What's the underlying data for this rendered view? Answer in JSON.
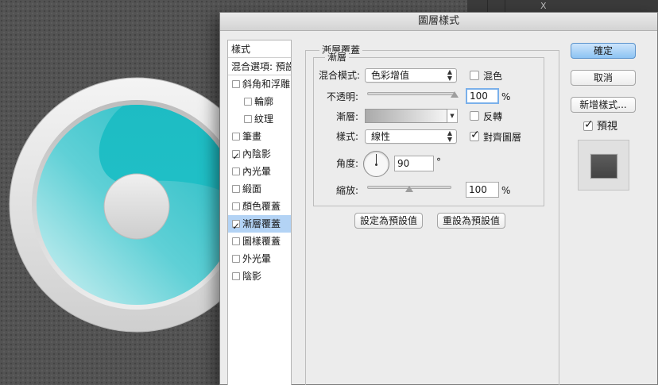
{
  "dialog": {
    "title": "圖層樣式"
  },
  "style_list": {
    "header": "樣式",
    "blending_options": "混合選項: 預設",
    "items": [
      {
        "label": "斜角和浮雕",
        "checked": false,
        "sub": false,
        "selected": false
      },
      {
        "label": "輪廓",
        "checked": false,
        "sub": true,
        "selected": false
      },
      {
        "label": "紋理",
        "checked": false,
        "sub": true,
        "selected": false
      },
      {
        "label": "筆畫",
        "checked": false,
        "sub": false,
        "selected": false
      },
      {
        "label": "內陰影",
        "checked": true,
        "sub": false,
        "selected": false
      },
      {
        "label": "內光暈",
        "checked": false,
        "sub": false,
        "selected": false
      },
      {
        "label": "緞面",
        "checked": false,
        "sub": false,
        "selected": false
      },
      {
        "label": "顏色覆蓋",
        "checked": false,
        "sub": false,
        "selected": false
      },
      {
        "label": "漸層覆蓋",
        "checked": true,
        "sub": false,
        "selected": true
      },
      {
        "label": "圖樣覆蓋",
        "checked": false,
        "sub": false,
        "selected": false
      },
      {
        "label": "外光暈",
        "checked": false,
        "sub": false,
        "selected": false
      },
      {
        "label": "陰影",
        "checked": false,
        "sub": false,
        "selected": false
      }
    ]
  },
  "panel": {
    "group_title": "漸層覆蓋",
    "inner_title": "漸層",
    "blend_mode_label": "混合模式:",
    "blend_mode_value": "色彩增值",
    "dither_label": "混色",
    "dither_checked": false,
    "opacity_label": "不透明:",
    "opacity_value": "100",
    "opacity_unit": "%",
    "opacity_level": 1.0,
    "gradient_label": "漸層:",
    "reverse_label": "反轉",
    "reverse_checked": false,
    "style_label": "樣式:",
    "style_value": "線性",
    "align_label": "對齊圖層",
    "align_checked": true,
    "angle_label": "角度:",
    "angle_value": "90",
    "angle_unit": "°",
    "scale_label": "縮放:",
    "scale_value": "100",
    "scale_unit": "%",
    "scale_level": 0.5,
    "make_default": "設定為預設值",
    "reset_default": "重設為預設值"
  },
  "actions": {
    "ok": "確定",
    "cancel": "取消",
    "new_style": "新增樣式...",
    "preview_label": "預視",
    "preview_checked": true
  },
  "background": {
    "panel_letter": "X"
  },
  "colors": {
    "accent_teal": "#21c0c8",
    "selected_row": "#b3d3f5",
    "primary_button": "#8dc3f3"
  }
}
